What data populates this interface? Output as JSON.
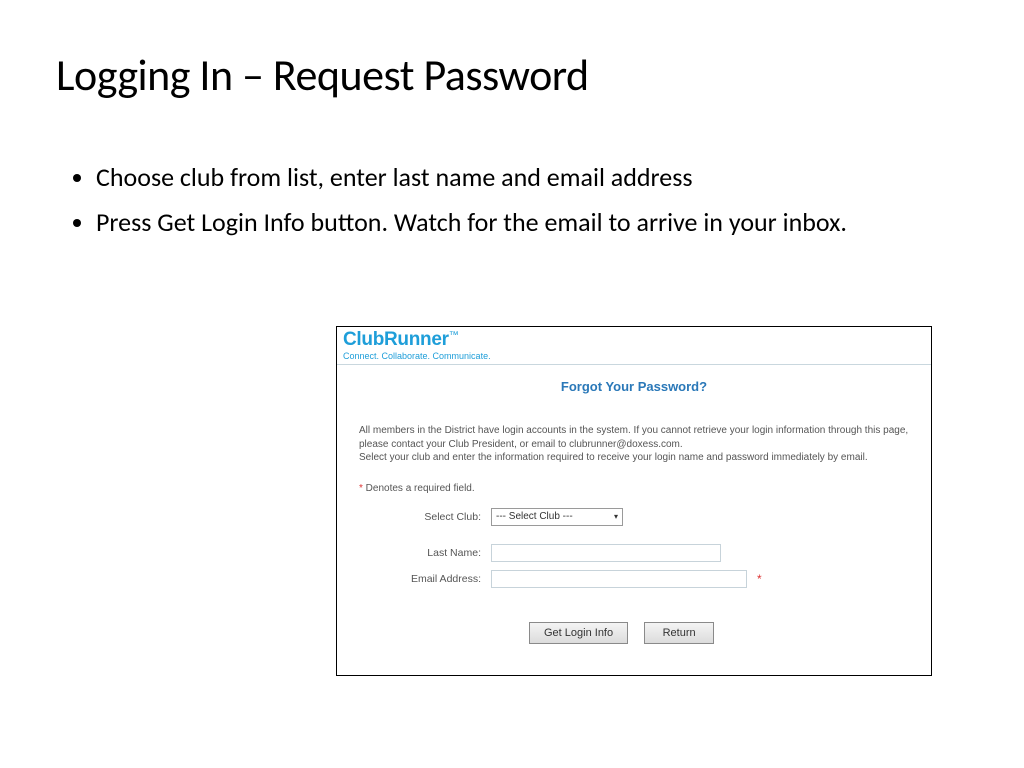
{
  "title": "Logging In – Request Password",
  "bullets": [
    "Choose club from list, enter last name and email address",
    "Press Get Login Info button. Watch for the email to arrive in your inbox."
  ],
  "panel": {
    "brand": {
      "name": "ClubRunner",
      "tm": "™",
      "tagline": "Connect. Collaborate. Communicate."
    },
    "heading": "Forgot Your Password?",
    "description_line1": "All members in the District have login accounts in the system. If you cannot retrieve your login information through this page, please contact your Club President, or email to clubrunner@doxess.com.",
    "description_line2": "Select your club and enter the information required to receive your login name and password immediately by email.",
    "required_note_ast": "*",
    "required_note_text": "  Denotes a required field.",
    "fields": {
      "select_club_label": "Select Club:",
      "select_club_value": "--- Select Club ---",
      "last_name_label": "Last Name:",
      "email_label": "Email Address:",
      "email_required_mark": "*"
    },
    "buttons": {
      "get_login_info": "Get Login Info",
      "return": "Return"
    }
  }
}
